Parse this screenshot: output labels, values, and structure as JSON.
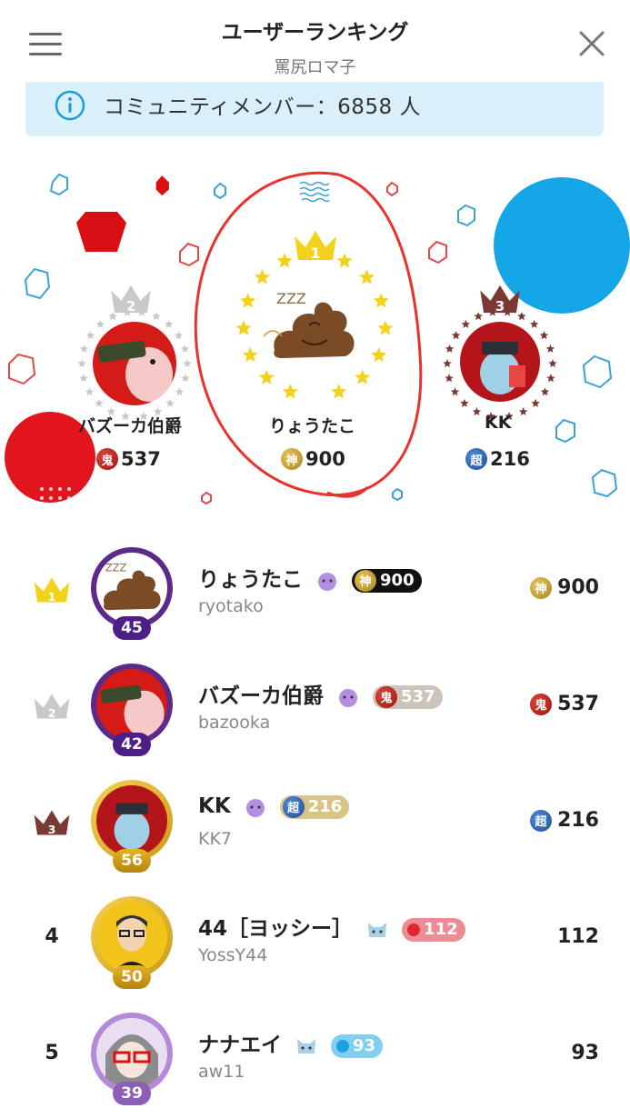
{
  "header": {
    "title": "ユーザーランキング",
    "subtitle": "罵尻ロマ子",
    "menu_icon": "hamburger-menu-icon",
    "close_icon": "close-icon"
  },
  "banner": {
    "text": "コミュニティメンバー：6858 人",
    "icon": "info-icon",
    "color": "#d9f0fa"
  },
  "podium": {
    "first": {
      "rank": "1",
      "name": "りょうたこ",
      "coin": "神",
      "score": "900"
    },
    "second": {
      "rank": "2",
      "name": "バズーカ伯爵",
      "coin": "鬼",
      "score": "537"
    },
    "third": {
      "rank": "3",
      "name": "KK",
      "coin": "超",
      "score": "216"
    }
  },
  "ranking": [
    {
      "rank": "1",
      "name": "りょうたこ",
      "handle": "ryotako",
      "level": "45",
      "badge_coin": "神",
      "badge_score": "900",
      "coin": "神",
      "score": "900"
    },
    {
      "rank": "2",
      "name": "バズーカ伯爵",
      "handle": "bazooka",
      "level": "42",
      "badge_coin": "鬼",
      "badge_score": "537",
      "coin": "鬼",
      "score": "537"
    },
    {
      "rank": "3",
      "name": "KK",
      "handle": "KK7",
      "level": "56",
      "badge_coin": "超",
      "badge_score": "216",
      "coin": "超",
      "score": "216"
    },
    {
      "rank": "4",
      "name": "44［ヨッシー］",
      "handle": "YossY44",
      "level": "50",
      "badge_score": "112",
      "score": "112"
    },
    {
      "rank": "5",
      "name": "ナナエイ",
      "handle": "aw11",
      "level": "39",
      "badge_score": "93",
      "score": "93"
    }
  ],
  "colors": {
    "gold": "#f2d21b",
    "silver": "#c9c9c9",
    "bronze": "#7a3a33",
    "accent_blue": "#14a6e6",
    "accent_red": "#e2141d",
    "annotation_red": "#e8332c"
  }
}
